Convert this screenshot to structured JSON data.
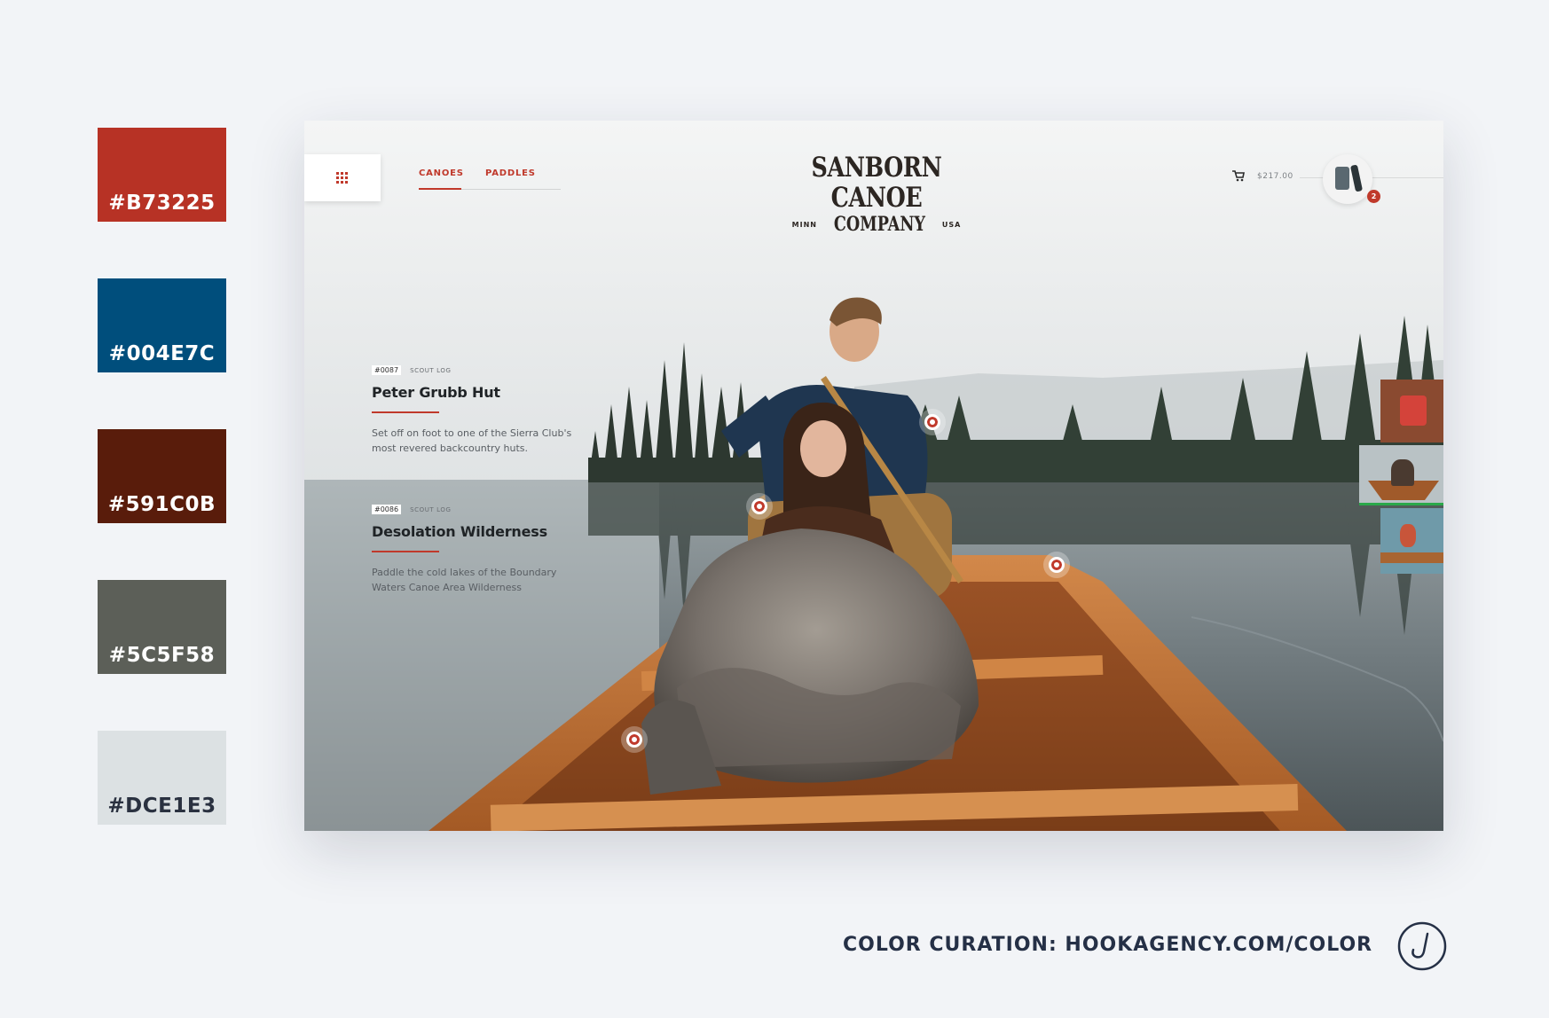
{
  "palette": [
    {
      "hex": "#B73225",
      "label": "#B73225"
    },
    {
      "hex": "#004E7C",
      "label": "#004E7C"
    },
    {
      "hex": "#591C0B",
      "label": "#591C0B"
    },
    {
      "hex": "#5C5F58",
      "label": "#5C5F58"
    },
    {
      "hex": "#DCE1E3",
      "label": "#DCE1E3"
    }
  ],
  "site": {
    "nav": {
      "canoes": "CANOES",
      "paddles": "PADDLES"
    },
    "logo": {
      "line1": "SANBORN CANOE",
      "line2": "COMPANY",
      "left_small": "MINN",
      "right_small": "USA"
    },
    "cart": {
      "total": "$217.00",
      "badge": "2"
    },
    "articles": [
      {
        "id": "#0087",
        "category": "SCOUT LOG",
        "title": "Peter Grubb Hut",
        "desc": "Set off on foot to one of the Sierra Club's most revered backcountry huts."
      },
      {
        "id": "#0086",
        "category": "SCOUT LOG",
        "title": "Desolation Wilderness",
        "desc": "Paddle the cold lakes of the Boundary Waters Canoe Area Wilderness"
      }
    ]
  },
  "footer": {
    "credit": "COLOR CURATION: HOOKAGENCY.COM/COLOR"
  },
  "icons": [
    "grid-menu-icon",
    "cart-icon",
    "hook-logo-icon"
  ]
}
